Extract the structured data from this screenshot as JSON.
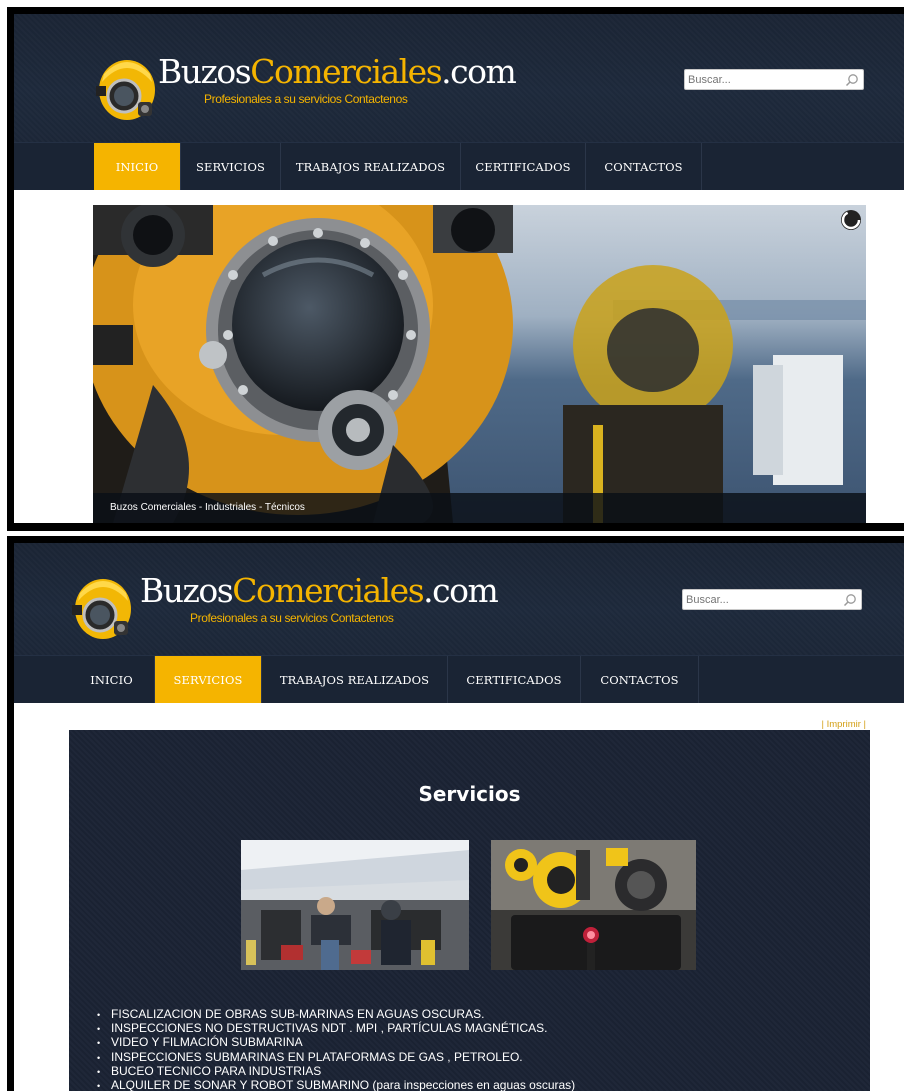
{
  "brand": {
    "name_part1": "Buzos",
    "name_part2": "Comerciales",
    "name_part3": ".com",
    "tagline": "Profesionales a su servicios Contactenos"
  },
  "search": {
    "placeholder": "Buscar..."
  },
  "nav": {
    "items": [
      {
        "label": "INICIO"
      },
      {
        "label": "SERVICIOS"
      },
      {
        "label": "TRABAJOS REALIZADOS"
      },
      {
        "label": "CERTIFICADOS"
      },
      {
        "label": "CONTACTOS"
      }
    ]
  },
  "screen1": {
    "active_nav": "INICIO",
    "slider": {
      "caption": "Buzos Comerciales - Industriales - Técnicos"
    }
  },
  "screen2": {
    "active_nav": "SERVICIOS",
    "print_link": "| Imprimir |",
    "article": {
      "title": "Servicios",
      "services": [
        "FISCALIZACION DE OBRAS SUB-MARINAS EN AGUAS OSCURAS.",
        "INSPECCIONES NO DESTRUCTIVAS   NDT .  MPI  ,  PARTÍCULAS MAGNÉTICAS.",
        "VIDEO Y FILMACIÓN SUBMARINA",
        "INSPECCIONES SUBMARINAS EN PLATAFORMAS DE GAS , PETROLEO.",
        "BUCEO  TECNICO PARA INDUSTRIAS",
        "ALQUILER DE SONAR Y  ROBOT  SUBMARINO (para inspecciones en aguas  oscuras)"
      ]
    }
  },
  "colors": {
    "accent": "#f5b400",
    "header_bg": "#1e2a3c",
    "nav_bg": "#1a2434",
    "article_bg": "#1b2334"
  }
}
